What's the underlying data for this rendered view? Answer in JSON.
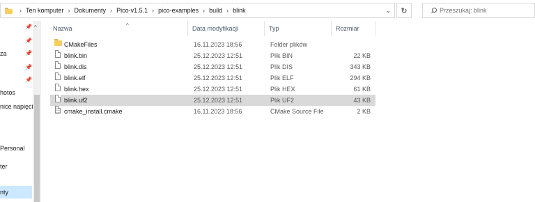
{
  "breadcrumb": [
    "Ten komputer",
    "Dokumenty",
    "Pico-v1.5.1",
    "pico-examples",
    "build",
    "blink"
  ],
  "search": {
    "placeholder": "Przeszukaj: blink"
  },
  "nav": {
    "items": [
      {
        "label": "",
        "pinned": true
      },
      {
        "label": "",
        "pinned": true
      },
      {
        "label": "za",
        "pinned": true
      },
      {
        "label": "",
        "pinned": true
      },
      {
        "label": "",
        "pinned": true
      },
      {
        "label": "hotos",
        "pinned": false
      },
      {
        "label": "nice napięci",
        "pinned": false
      },
      {
        "label": "Personal",
        "pinned": false
      },
      {
        "label": "ter",
        "pinned": false
      },
      {
        "label": "nty",
        "pinned": false
      }
    ]
  },
  "columns": {
    "name": "Nazwa",
    "date": "Data modyfikacji",
    "type": "Typ",
    "size": "Rozmiar"
  },
  "files": [
    {
      "name": "CMakeFiles",
      "date": "16.11.2023 18:56",
      "type": "Folder plików",
      "size": "",
      "icon": "folder-icon",
      "selected": false
    },
    {
      "name": "blink.bin",
      "date": "25.12.2023 12:51",
      "type": "Plik BIN",
      "size": "22 KB",
      "icon": "file-icon",
      "selected": false
    },
    {
      "name": "blink.dis",
      "date": "25.12.2023 12:51",
      "type": "Plik DIS",
      "size": "343 KB",
      "icon": "file-icon",
      "selected": false
    },
    {
      "name": "blink.elf",
      "date": "25.12.2023 12:51",
      "type": "Plik ELF",
      "size": "294 KB",
      "icon": "file-icon",
      "selected": false
    },
    {
      "name": "blink.hex",
      "date": "25.12.2023 12:51",
      "type": "Plik HEX",
      "size": "61 KB",
      "icon": "file-icon",
      "selected": false
    },
    {
      "name": "blink.uf2",
      "date": "25.12.2023 12:51",
      "type": "Plik UF2",
      "size": "43 KB",
      "icon": "file-icon",
      "selected": true
    },
    {
      "name": "cmake_install.cmake",
      "date": "16.11.2023 18:56",
      "type": "CMake Source File",
      "size": "2 KB",
      "icon": "text-file-icon",
      "selected": false
    }
  ]
}
